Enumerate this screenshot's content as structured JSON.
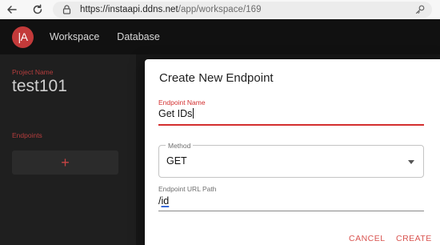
{
  "browser": {
    "url_host": "https://instaapi.ddns.net",
    "url_path": "/app/workspace/169"
  },
  "header": {
    "logo_text": "|A",
    "menu": [
      "Workspace",
      "Database"
    ]
  },
  "sidebar": {
    "project_label": "Project Name",
    "project_name": "test101",
    "endpoints_label": "Endpoints",
    "add_symbol": "+"
  },
  "dialog": {
    "title": "Create New Endpoint",
    "endpoint_name_label": "Endpoint Name",
    "endpoint_name_value": "Get IDs",
    "method_label": "Method",
    "method_value": "GET",
    "url_path_label": "Endpoint URL Path",
    "url_path_prefix": "/",
    "url_path_word": "id",
    "cancel_label": "CANCEL",
    "create_label": "CREATE"
  },
  "colors": {
    "accent": "#d32f2f",
    "header_bg": "#111111",
    "panel_bg": "#1f1f1f"
  },
  "icons": [
    "back-arrow-icon",
    "reload-icon",
    "lock-icon",
    "key-icon",
    "dropdown-arrow-icon",
    "plus-icon"
  ]
}
